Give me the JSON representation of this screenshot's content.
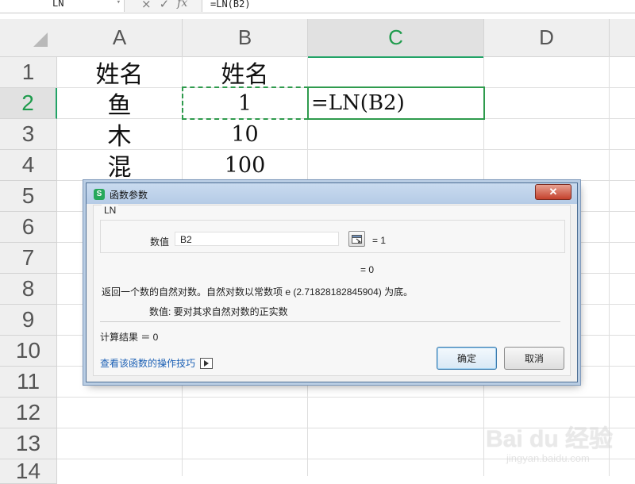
{
  "formula_bar": {
    "name_box": "LN",
    "cancel_icon": "×",
    "confirm_icon": "✓",
    "fx_label": "fx",
    "formula": "=LN(B2)"
  },
  "grid": {
    "columns": [
      "A",
      "B",
      "C",
      "D"
    ],
    "active_column": "C",
    "rows": [
      "1",
      "2",
      "3",
      "4",
      "5",
      "6",
      "7",
      "8",
      "9",
      "10",
      "11",
      "12",
      "13",
      "14"
    ],
    "active_row": "2",
    "cells": {
      "A1": "姓名",
      "B1": "姓名",
      "A2": "鱼",
      "B2": "1",
      "C2": "=LN(B2)",
      "A3": "木",
      "B3": "10",
      "A4": "混",
      "B4": "100"
    }
  },
  "dialog": {
    "title": "函数参数",
    "app_icon_letter": "S",
    "close_label": "✕",
    "function_name": "LN",
    "arg_label": "数值",
    "arg_value": "B2",
    "arg_result": "= 1",
    "result": "= 0",
    "description": "返回一个数的自然对数。自然对数以常数项 e (2.71828182845904) 为底。",
    "param_desc": "数值:   要对其求自然对数的正实数",
    "calc_result": "计算结果 ＝ 0",
    "help_link": "查看该函数的操作技巧",
    "ok_label": "确定",
    "cancel_label": "取消"
  },
  "watermark": {
    "text": "Bai du 经验",
    "sub": "jingyan.baidu.com"
  }
}
